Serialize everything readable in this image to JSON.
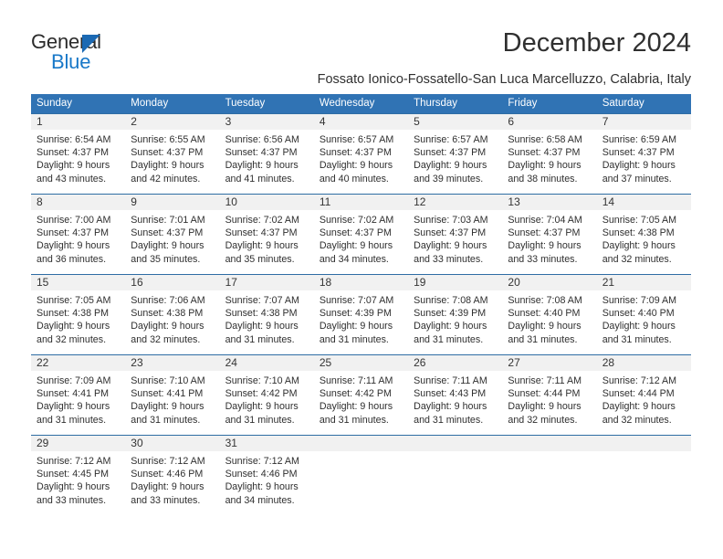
{
  "brand": {
    "line1": "General",
    "line2": "Blue",
    "triangle_icon": "brand-triangle-icon",
    "accent_color": "#1878c8",
    "dark_color": "#2b2b2b"
  },
  "header": {
    "title": "December 2024",
    "subtitle": "Fossato Ionico-Fossatello-San Luca Marcelluzzo, Calabria, Italy"
  },
  "calendar": {
    "header_bg": "#3073b4",
    "row_border_color": "#2e6da4",
    "day_band_bg": "#f1f1f1",
    "weekdays": [
      "Sunday",
      "Monday",
      "Tuesday",
      "Wednesday",
      "Thursday",
      "Friday",
      "Saturday"
    ],
    "weeks": [
      [
        {
          "day": "1",
          "lines": [
            "Sunrise: 6:54 AM",
            "Sunset: 4:37 PM",
            "Daylight: 9 hours",
            "and 43 minutes."
          ]
        },
        {
          "day": "2",
          "lines": [
            "Sunrise: 6:55 AM",
            "Sunset: 4:37 PM",
            "Daylight: 9 hours",
            "and 42 minutes."
          ]
        },
        {
          "day": "3",
          "lines": [
            "Sunrise: 6:56 AM",
            "Sunset: 4:37 PM",
            "Daylight: 9 hours",
            "and 41 minutes."
          ]
        },
        {
          "day": "4",
          "lines": [
            "Sunrise: 6:57 AM",
            "Sunset: 4:37 PM",
            "Daylight: 9 hours",
            "and 40 minutes."
          ]
        },
        {
          "day": "5",
          "lines": [
            "Sunrise: 6:57 AM",
            "Sunset: 4:37 PM",
            "Daylight: 9 hours",
            "and 39 minutes."
          ]
        },
        {
          "day": "6",
          "lines": [
            "Sunrise: 6:58 AM",
            "Sunset: 4:37 PM",
            "Daylight: 9 hours",
            "and 38 minutes."
          ]
        },
        {
          "day": "7",
          "lines": [
            "Sunrise: 6:59 AM",
            "Sunset: 4:37 PM",
            "Daylight: 9 hours",
            "and 37 minutes."
          ]
        }
      ],
      [
        {
          "day": "8",
          "lines": [
            "Sunrise: 7:00 AM",
            "Sunset: 4:37 PM",
            "Daylight: 9 hours",
            "and 36 minutes."
          ]
        },
        {
          "day": "9",
          "lines": [
            "Sunrise: 7:01 AM",
            "Sunset: 4:37 PM",
            "Daylight: 9 hours",
            "and 35 minutes."
          ]
        },
        {
          "day": "10",
          "lines": [
            "Sunrise: 7:02 AM",
            "Sunset: 4:37 PM",
            "Daylight: 9 hours",
            "and 35 minutes."
          ]
        },
        {
          "day": "11",
          "lines": [
            "Sunrise: 7:02 AM",
            "Sunset: 4:37 PM",
            "Daylight: 9 hours",
            "and 34 minutes."
          ]
        },
        {
          "day": "12",
          "lines": [
            "Sunrise: 7:03 AM",
            "Sunset: 4:37 PM",
            "Daylight: 9 hours",
            "and 33 minutes."
          ]
        },
        {
          "day": "13",
          "lines": [
            "Sunrise: 7:04 AM",
            "Sunset: 4:37 PM",
            "Daylight: 9 hours",
            "and 33 minutes."
          ]
        },
        {
          "day": "14",
          "lines": [
            "Sunrise: 7:05 AM",
            "Sunset: 4:38 PM",
            "Daylight: 9 hours",
            "and 32 minutes."
          ]
        }
      ],
      [
        {
          "day": "15",
          "lines": [
            "Sunrise: 7:05 AM",
            "Sunset: 4:38 PM",
            "Daylight: 9 hours",
            "and 32 minutes."
          ]
        },
        {
          "day": "16",
          "lines": [
            "Sunrise: 7:06 AM",
            "Sunset: 4:38 PM",
            "Daylight: 9 hours",
            "and 32 minutes."
          ]
        },
        {
          "day": "17",
          "lines": [
            "Sunrise: 7:07 AM",
            "Sunset: 4:38 PM",
            "Daylight: 9 hours",
            "and 31 minutes."
          ]
        },
        {
          "day": "18",
          "lines": [
            "Sunrise: 7:07 AM",
            "Sunset: 4:39 PM",
            "Daylight: 9 hours",
            "and 31 minutes."
          ]
        },
        {
          "day": "19",
          "lines": [
            "Sunrise: 7:08 AM",
            "Sunset: 4:39 PM",
            "Daylight: 9 hours",
            "and 31 minutes."
          ]
        },
        {
          "day": "20",
          "lines": [
            "Sunrise: 7:08 AM",
            "Sunset: 4:40 PM",
            "Daylight: 9 hours",
            "and 31 minutes."
          ]
        },
        {
          "day": "21",
          "lines": [
            "Sunrise: 7:09 AM",
            "Sunset: 4:40 PM",
            "Daylight: 9 hours",
            "and 31 minutes."
          ]
        }
      ],
      [
        {
          "day": "22",
          "lines": [
            "Sunrise: 7:09 AM",
            "Sunset: 4:41 PM",
            "Daylight: 9 hours",
            "and 31 minutes."
          ]
        },
        {
          "day": "23",
          "lines": [
            "Sunrise: 7:10 AM",
            "Sunset: 4:41 PM",
            "Daylight: 9 hours",
            "and 31 minutes."
          ]
        },
        {
          "day": "24",
          "lines": [
            "Sunrise: 7:10 AM",
            "Sunset: 4:42 PM",
            "Daylight: 9 hours",
            "and 31 minutes."
          ]
        },
        {
          "day": "25",
          "lines": [
            "Sunrise: 7:11 AM",
            "Sunset: 4:42 PM",
            "Daylight: 9 hours",
            "and 31 minutes."
          ]
        },
        {
          "day": "26",
          "lines": [
            "Sunrise: 7:11 AM",
            "Sunset: 4:43 PM",
            "Daylight: 9 hours",
            "and 31 minutes."
          ]
        },
        {
          "day": "27",
          "lines": [
            "Sunrise: 7:11 AM",
            "Sunset: 4:44 PM",
            "Daylight: 9 hours",
            "and 32 minutes."
          ]
        },
        {
          "day": "28",
          "lines": [
            "Sunrise: 7:12 AM",
            "Sunset: 4:44 PM",
            "Daylight: 9 hours",
            "and 32 minutes."
          ]
        }
      ],
      [
        {
          "day": "29",
          "lines": [
            "Sunrise: 7:12 AM",
            "Sunset: 4:45 PM",
            "Daylight: 9 hours",
            "and 33 minutes."
          ]
        },
        {
          "day": "30",
          "lines": [
            "Sunrise: 7:12 AM",
            "Sunset: 4:46 PM",
            "Daylight: 9 hours",
            "and 33 minutes."
          ]
        },
        {
          "day": "31",
          "lines": [
            "Sunrise: 7:12 AM",
            "Sunset: 4:46 PM",
            "Daylight: 9 hours",
            "and 34 minutes."
          ]
        },
        {
          "day": "",
          "lines": []
        },
        {
          "day": "",
          "lines": []
        },
        {
          "day": "",
          "lines": []
        },
        {
          "day": "",
          "lines": []
        }
      ]
    ]
  }
}
